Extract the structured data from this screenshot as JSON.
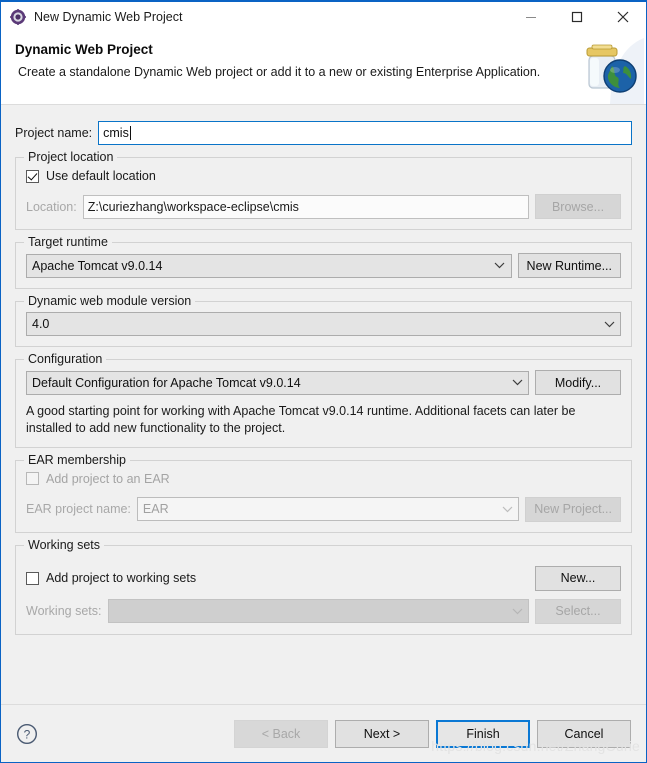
{
  "window": {
    "title": "New Dynamic Web Project",
    "icon": "eclipse-wizard-icon",
    "minimize_label": "Minimize",
    "maximize_label": "Maximize",
    "close_label": "Close"
  },
  "header": {
    "title": "Dynamic Web Project",
    "description": "Create a standalone Dynamic Web project or add it to a new or existing Enterprise Application.",
    "banner_icon": "jar-globe-icon"
  },
  "project_name": {
    "label": "Project name:",
    "value": "cmis",
    "placeholder": ""
  },
  "project_location": {
    "legend": "Project location",
    "use_default_label": "Use default location",
    "use_default_checked": true,
    "location_label": "Location:",
    "location_value": "Z:\\curiezhang\\workspace-eclipse\\cmis",
    "browse_label": "Browse..."
  },
  "target_runtime": {
    "legend": "Target runtime",
    "value": "Apache Tomcat v9.0.14",
    "new_runtime_label": "New Runtime..."
  },
  "module_version": {
    "legend": "Dynamic web module version",
    "value": "4.0"
  },
  "configuration": {
    "legend": "Configuration",
    "value": "Default Configuration for Apache Tomcat v9.0.14",
    "modify_label": "Modify...",
    "description": "A good starting point for working with Apache Tomcat v9.0.14 runtime. Additional facets can later be installed to add new functionality to the project."
  },
  "ear_membership": {
    "legend": "EAR membership",
    "add_to_ear_label": "Add project to an EAR",
    "add_to_ear_checked": false,
    "ear_name_label": "EAR project name:",
    "ear_name_value": "EAR",
    "new_project_label": "New Project..."
  },
  "working_sets": {
    "legend": "Working sets",
    "add_label": "Add project to working sets",
    "add_checked": false,
    "new_label": "New...",
    "sets_label": "Working sets:",
    "sets_value": "",
    "select_label": "Select..."
  },
  "footer": {
    "help_icon": "help-icon",
    "back_label": "< Back",
    "next_label": "Next >",
    "finish_label": "Finish",
    "cancel_label": "Cancel"
  },
  "watermark": {
    "text": "https://blog.csdn.net/ZhangCurie"
  },
  "colors": {
    "accent": "#0a78d4",
    "window_border": "#0a63c4",
    "dialog_bg": "#f0f0f0",
    "disabled_text": "#a8a8a8"
  }
}
